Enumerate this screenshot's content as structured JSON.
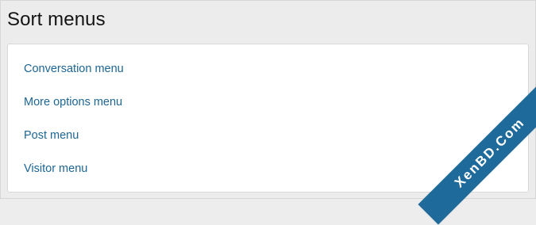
{
  "page": {
    "title": "Sort menus"
  },
  "menus": [
    {
      "label": "Conversation menu"
    },
    {
      "label": "More options menu"
    },
    {
      "label": "Post menu"
    },
    {
      "label": "Visitor menu"
    }
  ],
  "watermark": {
    "text": "XenBD.Com"
  },
  "colors": {
    "link": "#1d6593",
    "ribbon": "#1e6a9a",
    "background": "#ededed"
  }
}
